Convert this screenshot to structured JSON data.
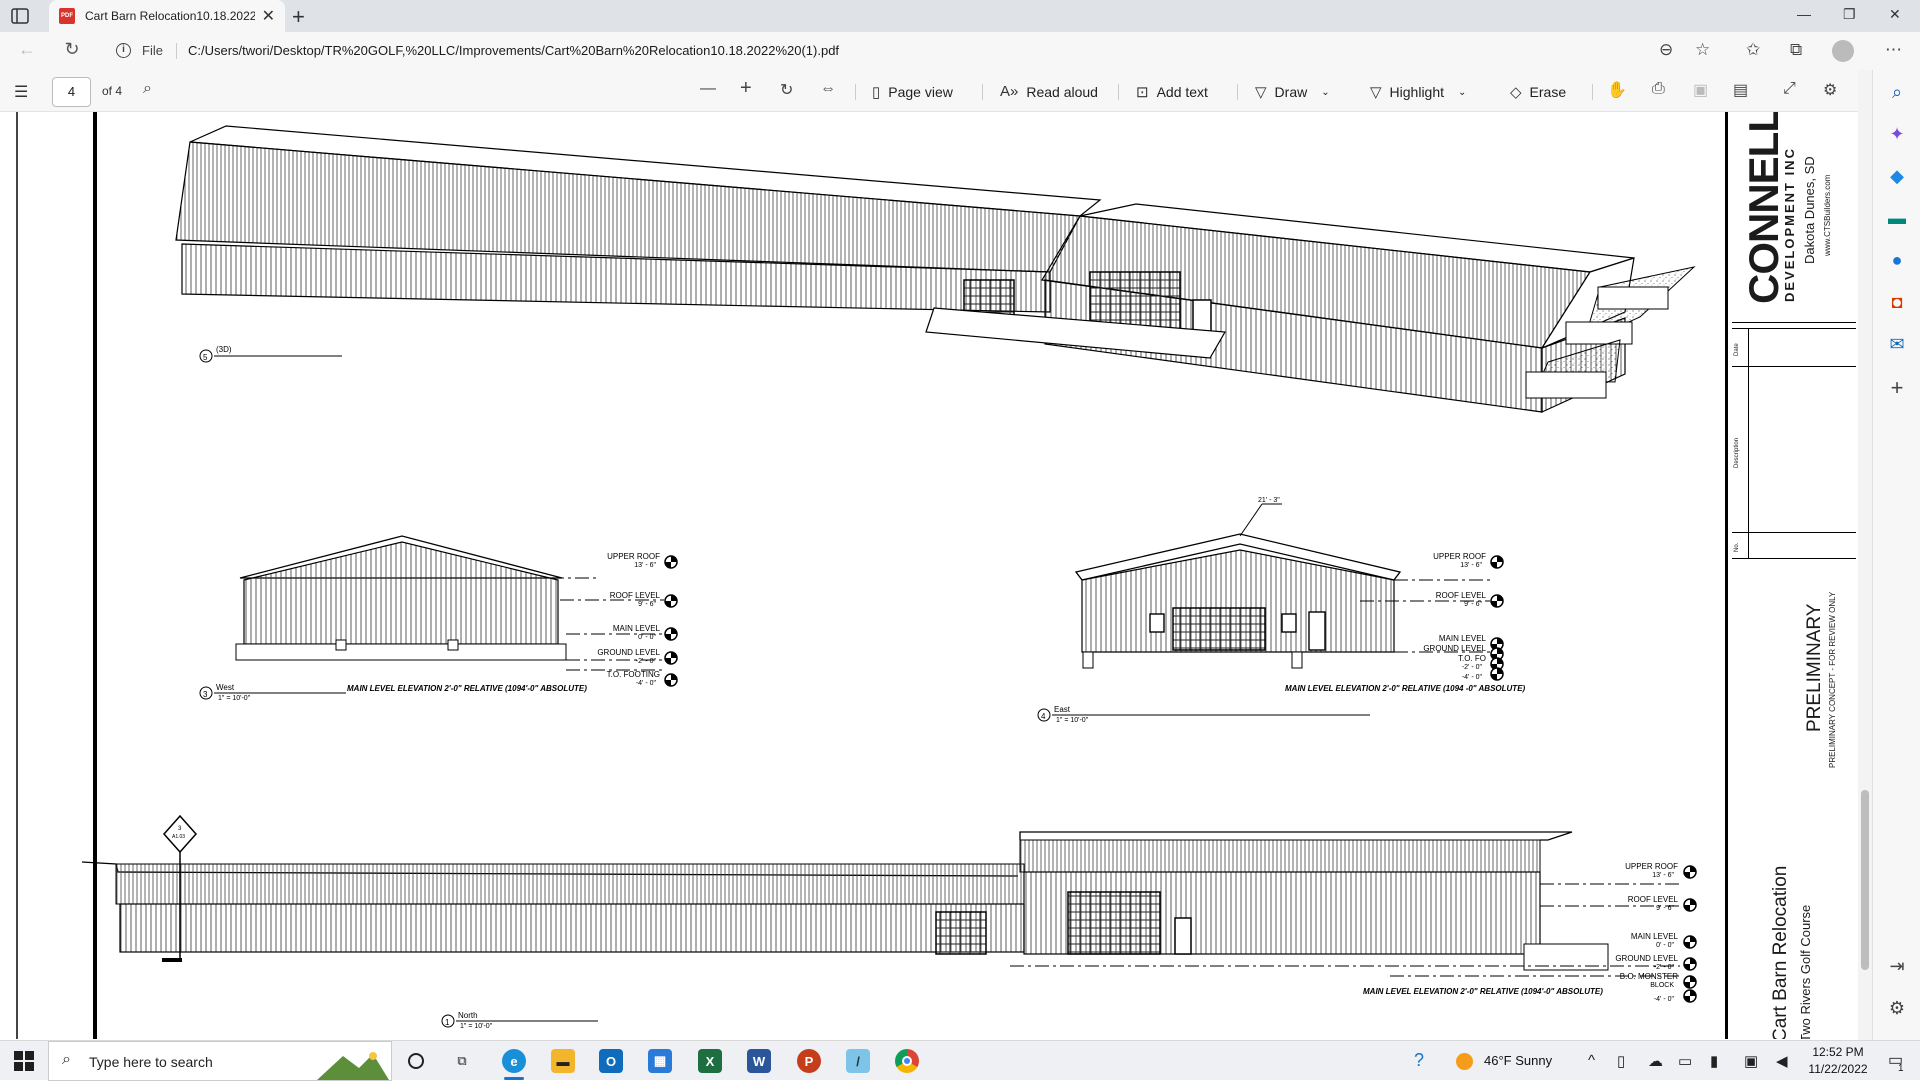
{
  "browser": {
    "tab_title": "Cart Barn Relocation10.18.2022",
    "tab_favicon": "pdf-file-icon",
    "file_label": "File",
    "url": "C:/Users/twori/Desktop/TR%20GOLF,%20LLC/Improvements/Cart%20Barn%20Relocation10.18.2022%20(1).pdf"
  },
  "pdf_toolbar": {
    "page_number": "4",
    "page_total": "of 4",
    "page_view": "Page view",
    "read_aloud": "Read aloud",
    "add_text": "Add text",
    "draw": "Draw",
    "highlight": "Highlight",
    "erase": "Erase"
  },
  "drawing": {
    "view_3d": {
      "num": "5",
      "label": "(3D)"
    },
    "west": {
      "num": "3",
      "label": "West",
      "scale": "1\" = 10'-0\"",
      "note": "MAIN LEVEL ELEVATION 2'-0\" RELATIVE (1094'-0\" ABSOLUTE)",
      "levels": [
        {
          "name": "UPPER ROOF",
          "value": "13' - 6\""
        },
        {
          "name": "ROOF LEVEL",
          "value": "9' - 6\""
        },
        {
          "name": "MAIN LEVEL",
          "value": "0' - 0\""
        },
        {
          "name": "GROUND LEVEL",
          "value": "-2' - 0\""
        },
        {
          "name": "T.O. FOOTING",
          "value": "-4' - 0\""
        }
      ]
    },
    "east": {
      "num": "4",
      "label": "East",
      "scale": "1\" = 10'-0\"",
      "dim": "21' - 3\"",
      "note": "MAIN LEVEL ELEVATION 2'-0\" RELATIVE (1094 -0\" ABSOLUTE)",
      "levels": [
        {
          "name": "UPPER ROOF",
          "value": "13' - 6\""
        },
        {
          "name": "ROOF LEVEL",
          "value": "9' - 6\""
        },
        {
          "name": "MAIN LEVEL",
          "value": ""
        },
        {
          "name": "GROUND LEVEL",
          "value": ""
        },
        {
          "name": "T.O. FO",
          "value": "-2' - 0\""
        },
        {
          "name": "",
          "value": "-4' - 0\""
        }
      ]
    },
    "north": {
      "num": "1",
      "label": "North",
      "scale": "1\" = 10'-0\"",
      "section_tag": "3",
      "section_sheet": "A1.03",
      "note": "MAIN LEVEL ELEVATION 2'-0\" RELATIVE (1094'-0\" ABSOLUTE)",
      "levels": [
        {
          "name": "UPPER ROOF",
          "value": "13' - 6\""
        },
        {
          "name": "ROOF LEVEL",
          "value": "9' - 6\""
        },
        {
          "name": "MAIN LEVEL",
          "value": "0' - 0\""
        },
        {
          "name": "GROUND LEVEL",
          "value": "-2' - 0\""
        },
        {
          "name": "B.O. MONSTER",
          "value": "BLOCK"
        },
        {
          "name": "",
          "value": "-4' - 0\""
        }
      ]
    }
  },
  "titleblock": {
    "company": "CONNELLY",
    "company_sub": "DEVELOPMENT INC",
    "location": "Dakota Dunes, SD",
    "website": "www.CTSBuilders.com",
    "date_label": "Date",
    "description_label": "Description",
    "no_label": "No.",
    "preliminary": "PRELIMINARY",
    "preliminary_note": "PRELIMINARY CONCEPT - FOR REVIEW ONLY",
    "project": "Cart Barn Relocation",
    "client": "Two Rivers Golf Course"
  },
  "taskbar": {
    "search_placeholder": "Type here to search",
    "weather": "46°F  Sunny",
    "time": "12:52 PM",
    "date": "11/22/2022",
    "notifications": "1"
  },
  "colors": {
    "accent": "#1a73c8",
    "preliminary_red": "#d0021b",
    "pdf_red": "#d9342b",
    "excel_green": "#1d6f42",
    "word_blue": "#2b579a",
    "ppt_orange": "#c43e1c",
    "outlook_blue": "#0f6cbd"
  }
}
